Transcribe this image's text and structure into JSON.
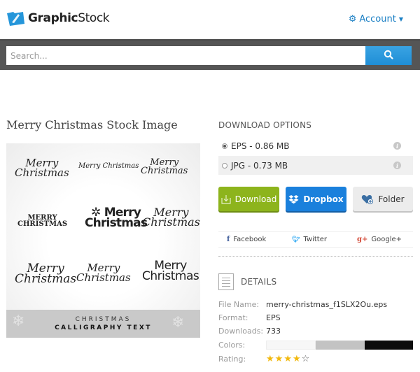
{
  "header": {
    "brand_bold": "Graphic",
    "brand_light": "Stock",
    "account_label": "Account",
    "account_icon": "gear-icon"
  },
  "search": {
    "placeholder": "Search...",
    "value": "",
    "button_icon": "search-icon"
  },
  "page": {
    "title": "Merry Christmas Stock Image"
  },
  "preview": {
    "samples": [
      "Merry Christmas",
      "Merry Christmas",
      "Merry Christmas",
      "Merry Christmas",
      "Merry Christmas",
      "Merry Christmas",
      "Merry Christmas",
      "Merry Christmas",
      "Merry Christmas"
    ],
    "banner_line1": "CHRISTMAS",
    "banner_line2": "CALLIGRAPHY TEXT"
  },
  "download_options": {
    "heading": "DOWNLOAD OPTIONS",
    "options": [
      {
        "label": "EPS - 0.86 MB",
        "selected": true
      },
      {
        "label": "JPG - 0.73 MB",
        "selected": false
      }
    ],
    "buttons": {
      "download": "Download",
      "dropbox": "Dropbox",
      "folder": "Folder"
    }
  },
  "share": {
    "facebook": "Facebook",
    "twitter": "Twitter",
    "google": "Google+"
  },
  "details": {
    "heading": "DETAILS",
    "file_name_label": "File Name:",
    "file_name": "merry-christmas_f1SLX2Ou.eps",
    "format_label": "Format:",
    "format": "EPS",
    "downloads_label": "Downloads:",
    "downloads": "733",
    "colors_label": "Colors:",
    "colors": [
      "#f7f7f7",
      "#c3c3c3",
      "#0c0c0c"
    ],
    "rating_label": "Rating:",
    "rating": 4,
    "rating_max": 5
  },
  "colors": {
    "accent_blue": "#1a7fc4",
    "search_button": "#2596da",
    "download_green": "#8db41c",
    "dropbox_blue": "#1a80dc",
    "star_yellow": "#f2b90f"
  }
}
